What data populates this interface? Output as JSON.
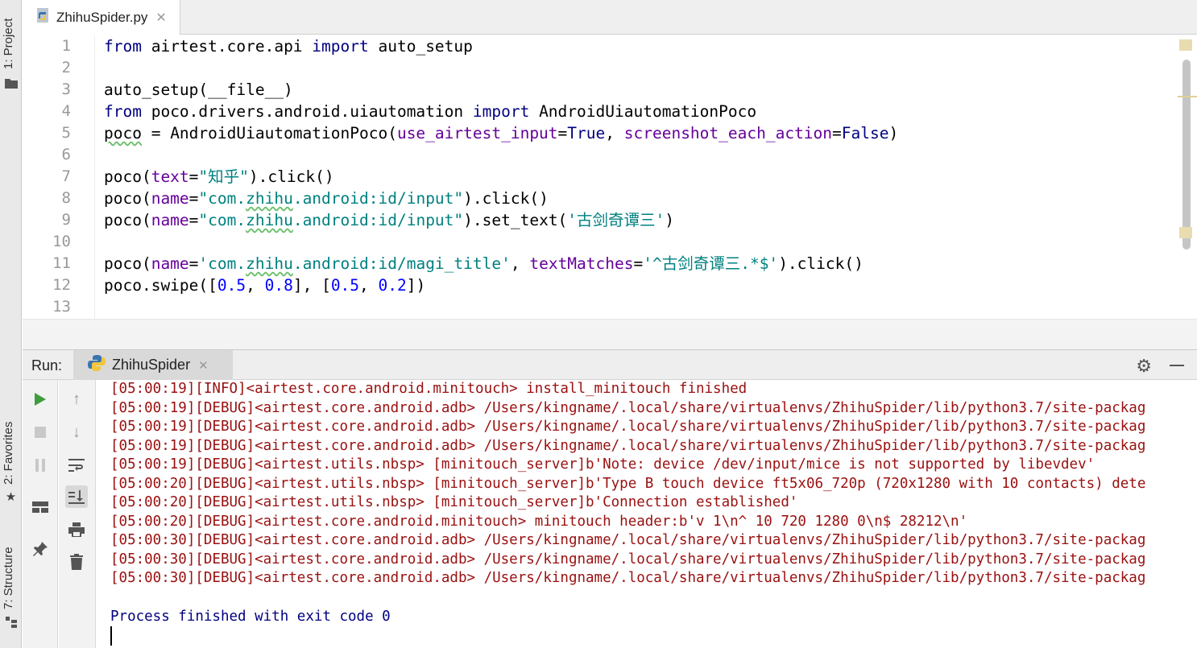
{
  "sidebar": {
    "project_tab": "1: Project",
    "favorites_tab": "2: Favorites",
    "structure_tab": "7: Structure"
  },
  "editor": {
    "tab_label": "ZhihuSpider.py",
    "line_numbers": [
      "1",
      "2",
      "3",
      "4",
      "5",
      "6",
      "7",
      "8",
      "9",
      "10",
      "11",
      "12",
      "13"
    ],
    "code": {
      "l1_from": "from",
      "l1_mod": " airtest.core.api ",
      "l1_import": "import",
      "l1_name": " auto_setup",
      "l3": "auto_setup(__file__)",
      "l4_from": "from",
      "l4_mod": " poco.drivers.android.uiautomation ",
      "l4_import": "import",
      "l4_name": " AndroidUiautomationPoco",
      "l5_poco": "poco",
      "l5_a": " = AndroidUiautomationPoco(",
      "l5_kw1": "use_airtest_input",
      "l5_b": "=",
      "l5_v1": "True",
      "l5_c": ", ",
      "l5_kw2": "screenshot_each_action",
      "l5_d": "=",
      "l5_v2": "False",
      "l5_e": ")",
      "l7_a": "poco(",
      "l7_kw": "text",
      "l7_b": "=",
      "l7_s": "\"知乎\"",
      "l7_c": ").click()",
      "l8_a": "poco(",
      "l8_kw": "name",
      "l8_b": "=",
      "l8_s1": "\"com.",
      "l8_s2": "zhihu",
      "l8_s3": ".android:id/input\"",
      "l8_c": ").click()",
      "l9_a": "poco(",
      "l9_kw": "name",
      "l9_b": "=",
      "l9_s1": "\"com.",
      "l9_s2": "zhihu",
      "l9_s3": ".android:id/input\"",
      "l9_c": ").set_text(",
      "l9_s4": "'古剑奇谭三'",
      "l9_d": ")",
      "l11_a": "poco(",
      "l11_kw1": "name",
      "l11_b": "=",
      "l11_s1": "'com.",
      "l11_s2": "zhihu",
      "l11_s3": ".android:id/magi_title'",
      "l11_c": ", ",
      "l11_kw2": "textMatches",
      "l11_d": "=",
      "l11_s4": "'^古剑奇谭三.*$'",
      "l11_e": ").click()",
      "l12_a": "poco.swipe([",
      "l12_n1": "0.5",
      "l12_b": ", ",
      "l12_n2": "0.8",
      "l12_c": "], [",
      "l12_n3": "0.5",
      "l12_d": ", ",
      "l12_n4": "0.2",
      "l12_e": "])"
    }
  },
  "run_panel": {
    "label": "Run:",
    "tab_label": "ZhihuSpider",
    "log_lines": [
      "[05:00:19][INFO]<airtest.core.android.minitouch> install_minitouch finished",
      "[05:00:19][DEBUG]<airtest.core.android.adb> /Users/kingname/.local/share/virtualenvs/ZhihuSpider/lib/python3.7/site-packag",
      "[05:00:19][DEBUG]<airtest.core.android.adb> /Users/kingname/.local/share/virtualenvs/ZhihuSpider/lib/python3.7/site-packag",
      "[05:00:19][DEBUG]<airtest.core.android.adb> /Users/kingname/.local/share/virtualenvs/ZhihuSpider/lib/python3.7/site-packag",
      "[05:00:19][DEBUG]<airtest.utils.nbsp> [minitouch_server]b'Note: device /dev/input/mice is not supported by libevdev'",
      "[05:00:20][DEBUG]<airtest.utils.nbsp> [minitouch_server]b'Type B touch device ft5x06_720p (720x1280 with 10 contacts) dete",
      "[05:00:20][DEBUG]<airtest.utils.nbsp> [minitouch_server]b'Connection established'",
      "[05:00:20][DEBUG]<airtest.core.android.minitouch> minitouch header:b'v 1\\n^ 10 720 1280 0\\n$ 28212\\n'",
      "[05:00:30][DEBUG]<airtest.core.android.adb> /Users/kingname/.local/share/virtualenvs/ZhihuSpider/lib/python3.7/site-packag",
      "[05:00:30][DEBUG]<airtest.core.android.adb> /Users/kingname/.local/share/virtualenvs/ZhihuSpider/lib/python3.7/site-packag",
      "[05:00:30][DEBUG]<airtest.core.android.adb> /Users/kingname/.local/share/virtualenvs/ZhihuSpider/lib/python3.7/site-packag"
    ],
    "finish_message": "Process finished with exit code 0"
  },
  "icons": {
    "run": "play-icon",
    "stop": "stop-icon",
    "pause": "pause-icon",
    "layout": "layout-icon",
    "pin": "pin-icon",
    "up": "arrow-up-icon",
    "down": "arrow-down-icon",
    "wrap": "soft-wrap-icon",
    "scroll_end": "scroll-to-end-icon",
    "print": "print-icon",
    "trash": "trash-icon",
    "settings": "gear-icon"
  },
  "colors": {
    "log_text": "#9a1010",
    "finish_text": "#000080",
    "keyword": "#000080",
    "string": "#008080",
    "number": "#0000ff",
    "kwarg": "#660099",
    "run_green": "#3e9e3e"
  }
}
